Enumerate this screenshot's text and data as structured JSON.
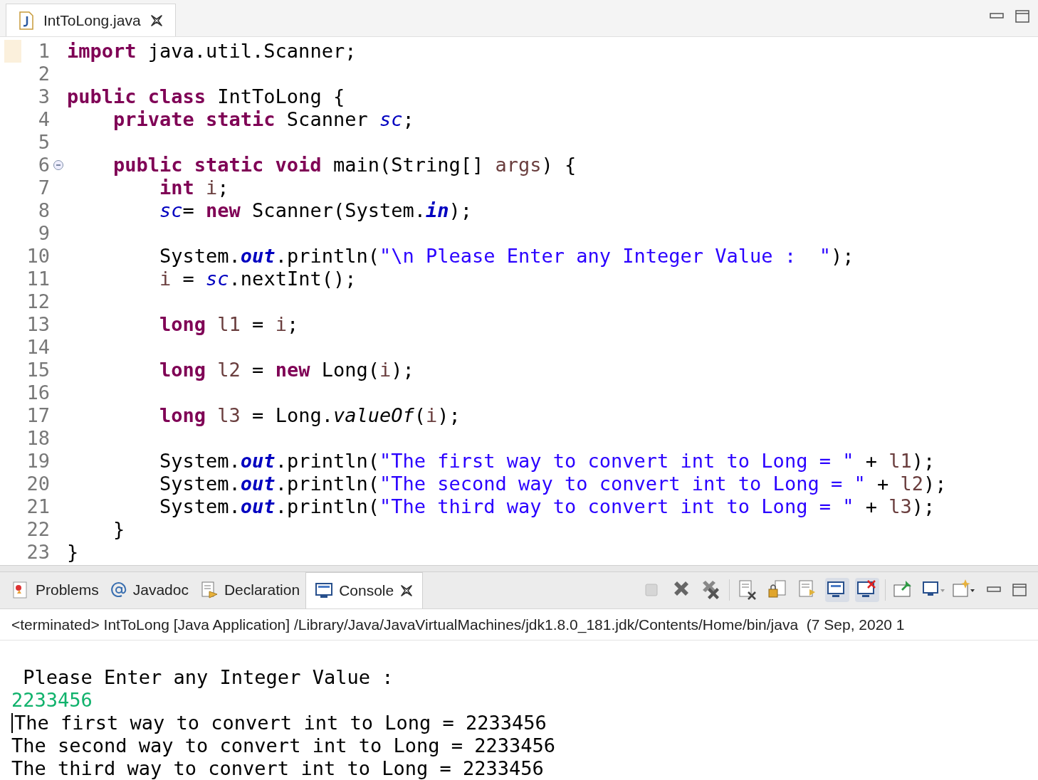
{
  "editor": {
    "tab": {
      "title": "IntToLong.java",
      "selected": true
    },
    "lines": [
      {
        "number": "1",
        "tokens": [
          {
            "kind": "keyword",
            "text": "import"
          },
          {
            "kind": "plain",
            "text": " java.util.Scanner;"
          }
        ]
      },
      {
        "number": "2"
      },
      {
        "number": "3",
        "tokens": [
          {
            "kind": "keyword",
            "text": "public class"
          },
          {
            "kind": "plain",
            "text": " IntToLong {"
          }
        ]
      },
      {
        "number": "4",
        "tokens": [
          {
            "kind": "keyword",
            "text": "    private static"
          },
          {
            "kind": "plain",
            "text": " Scanner "
          },
          {
            "kind": "field",
            "text": "sc"
          },
          {
            "kind": "plain",
            "text": ";"
          }
        ]
      },
      {
        "number": "5"
      },
      {
        "number": "6",
        "fold": {
          "expanded": true
        },
        "tokens": [
          {
            "kind": "keyword",
            "text": "    public static void"
          },
          {
            "kind": "plain",
            "text": " main(String[] "
          },
          {
            "kind": "local",
            "text": "args"
          },
          {
            "kind": "plain",
            "text": ") {"
          }
        ]
      },
      {
        "number": "7",
        "tokens": [
          {
            "kind": "keyword",
            "text": "        int "
          },
          {
            "kind": "local",
            "text": "i"
          },
          {
            "kind": "plain",
            "text": ";"
          }
        ]
      },
      {
        "number": "8",
        "tokens": [
          {
            "kind": "field",
            "text": "        sc"
          },
          {
            "kind": "plain",
            "text": "= "
          },
          {
            "kind": "keyword",
            "text": "new"
          },
          {
            "kind": "plain",
            "text": " Scanner(System."
          },
          {
            "kind": "static_field",
            "text": "in"
          },
          {
            "kind": "plain",
            "text": ");"
          }
        ]
      },
      {
        "number": "9"
      },
      {
        "number": "10",
        "tokens": [
          {
            "kind": "plain",
            "text": "        System."
          },
          {
            "kind": "static_field",
            "text": "out"
          },
          {
            "kind": "plain",
            "text": ".println("
          },
          {
            "kind": "string",
            "text": "\"\\n Please Enter any Integer Value :  \""
          },
          {
            "kind": "plain",
            "text": ");"
          }
        ]
      },
      {
        "number": "11",
        "tokens": [
          {
            "kind": "local",
            "text": "        i"
          },
          {
            "kind": "plain",
            "text": " = "
          },
          {
            "kind": "field",
            "text": "sc"
          },
          {
            "kind": "plain",
            "text": ".nextInt();"
          }
        ]
      },
      {
        "number": "12"
      },
      {
        "number": "13",
        "tokens": [
          {
            "kind": "keyword",
            "text": "        long"
          },
          {
            "kind": "local",
            "text": " l1"
          },
          {
            "kind": "plain",
            "text": " = "
          },
          {
            "kind": "local",
            "text": "i"
          },
          {
            "kind": "plain",
            "text": ";"
          }
        ]
      },
      {
        "number": "14"
      },
      {
        "number": "15",
        "tokens": [
          {
            "kind": "keyword",
            "text": "        long"
          },
          {
            "kind": "local",
            "text": " l2"
          },
          {
            "kind": "plain",
            "text": " = "
          },
          {
            "kind": "keyword",
            "text": "new"
          },
          {
            "kind": "plain",
            "text": " Long("
          },
          {
            "kind": "local",
            "text": "i"
          },
          {
            "kind": "plain",
            "text": ");"
          }
        ]
      },
      {
        "number": "16"
      },
      {
        "number": "17",
        "tokens": [
          {
            "kind": "keyword",
            "text": "        long"
          },
          {
            "kind": "local",
            "text": " l3"
          },
          {
            "kind": "plain",
            "text": " = Long."
          },
          {
            "kind": "static_method",
            "text": "valueOf"
          },
          {
            "kind": "plain",
            "text": "("
          },
          {
            "kind": "local",
            "text": "i"
          },
          {
            "kind": "plain",
            "text": ");"
          }
        ]
      },
      {
        "number": "18"
      },
      {
        "number": "19",
        "tokens": [
          {
            "kind": "plain",
            "text": "        System."
          },
          {
            "kind": "static_field",
            "text": "out"
          },
          {
            "kind": "plain",
            "text": ".println("
          },
          {
            "kind": "string",
            "text": "\"The first way to convert int to Long = \""
          },
          {
            "kind": "plain",
            "text": " + "
          },
          {
            "kind": "local",
            "text": "l1"
          },
          {
            "kind": "plain",
            "text": ");"
          }
        ]
      },
      {
        "number": "20",
        "tokens": [
          {
            "kind": "plain",
            "text": "        System."
          },
          {
            "kind": "static_field",
            "text": "out"
          },
          {
            "kind": "plain",
            "text": ".println("
          },
          {
            "kind": "string",
            "text": "\"The second way to convert int to Long = \""
          },
          {
            "kind": "plain",
            "text": " + "
          },
          {
            "kind": "local",
            "text": "l2"
          },
          {
            "kind": "plain",
            "text": ");"
          }
        ]
      },
      {
        "number": "21",
        "tokens": [
          {
            "kind": "plain",
            "text": "        System."
          },
          {
            "kind": "static_field",
            "text": "out"
          },
          {
            "kind": "plain",
            "text": ".println("
          },
          {
            "kind": "string",
            "text": "\"The third way to convert int to Long = \""
          },
          {
            "kind": "plain",
            "text": " + "
          },
          {
            "kind": "local",
            "text": "l3"
          },
          {
            "kind": "plain",
            "text": ");"
          }
        ]
      },
      {
        "number": "22",
        "tokens": [
          {
            "kind": "plain",
            "text": "    }"
          }
        ]
      },
      {
        "number": "23",
        "tokens": [
          {
            "kind": "plain",
            "text": "}"
          }
        ]
      }
    ]
  },
  "console": {
    "tabs": [
      {
        "label": "Problems",
        "kind": "problems",
        "selected": false
      },
      {
        "label": "Javadoc",
        "kind": "javadoc",
        "selected": false
      },
      {
        "label": "Declaration",
        "kind": "declaration",
        "selected": false
      },
      {
        "label": "Console",
        "kind": "console",
        "selected": true
      }
    ],
    "status": "<terminated> IntToLong [Java Application] /Library/Java/JavaVirtualMachines/jdk1.8.0_181.jdk/Contents/Home/bin/java  (7 Sep, 2020 1",
    "output": [
      {
        "kind": "output",
        "text": " Please Enter any Integer Value :"
      },
      {
        "kind": "input",
        "text": "2233456"
      },
      {
        "kind": "output",
        "text": "The first way to convert int to Long = 2233456"
      },
      {
        "kind": "output",
        "text": "The second way to convert int to Long = 2233456"
      },
      {
        "kind": "output",
        "text": "The third way to convert int to Long = 2233456"
      }
    ]
  }
}
